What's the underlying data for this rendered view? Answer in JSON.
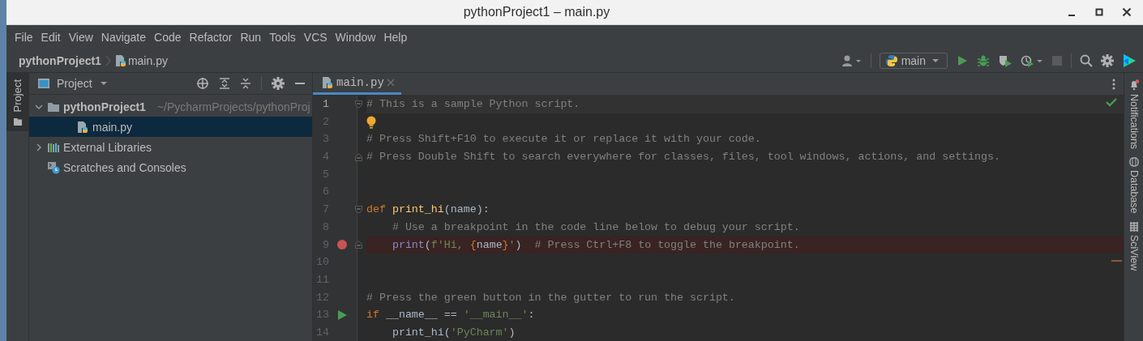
{
  "window": {
    "title": "pythonProject1 – main.py"
  },
  "menu": [
    "File",
    "Edit",
    "View",
    "Navigate",
    "Code",
    "Refactor",
    "Run",
    "Tools",
    "VCS",
    "Window",
    "Help"
  ],
  "breadcrumbs": [
    {
      "label": "pythonProject1",
      "kind": "project"
    },
    {
      "label": "main.py",
      "kind": "python-file"
    }
  ],
  "run_config": {
    "label": "main"
  },
  "left_strip": [
    {
      "label": "Project",
      "selected": true
    }
  ],
  "project_panel": {
    "title": "Project",
    "tree": [
      {
        "label": "pythonProject1",
        "path": "~/PycharmProjects/pythonProj",
        "kind": "folder",
        "expanded": true,
        "selected": false,
        "children": [
          {
            "label": "main.py",
            "kind": "python-file",
            "selected": true
          }
        ]
      },
      {
        "label": "External Libraries",
        "kind": "libraries",
        "expanded": false,
        "selected": false
      },
      {
        "label": "Scratches and Consoles",
        "kind": "scratches",
        "selected": false
      }
    ]
  },
  "editor": {
    "tabs": [
      {
        "label": "main.py",
        "selected": true
      }
    ],
    "lines": [
      {
        "number": "1",
        "current": true,
        "fold": {
          "kind": "start"
        },
        "tokens": [
          {
            "kind": "comment",
            "text": "# This is a sample Python script."
          }
        ]
      },
      {
        "number": "2",
        "current": false,
        "marker": {
          "kind": "bulb"
        }
      },
      {
        "number": "3",
        "current": false,
        "tokens": [
          {
            "kind": "comment",
            "text": "# Press Shift+F10 to execute it or replace it with your code."
          }
        ]
      },
      {
        "number": "4",
        "current": false,
        "fold": {
          "kind": "end"
        },
        "tokens": [
          {
            "kind": "comment",
            "text": "# Press Double Shift to search everywhere for classes, files, tool windows, actions, and settings."
          }
        ]
      },
      {
        "number": "5",
        "current": false
      },
      {
        "number": "6",
        "current": false
      },
      {
        "number": "7",
        "current": false,
        "fold": {
          "kind": "start"
        },
        "tokens": [
          {
            "kind": "keyword",
            "text": "def"
          },
          {
            "kind": "function",
            "text": " print_hi"
          },
          {
            "kind": "plain",
            "text": "(name):"
          }
        ]
      },
      {
        "number": "8",
        "current": false,
        "tokens": [
          {
            "kind": "comment",
            "text": "    # Use a breakpoint in the code line below to debug your script."
          }
        ]
      },
      {
        "number": "9",
        "current": false,
        "fold": {
          "kind": "end"
        },
        "marker": {
          "kind": "breakpoint"
        },
        "tokens": [
          {
            "kind": "builtin",
            "text": "    print"
          },
          {
            "kind": "plain",
            "text": "("
          },
          {
            "kind": "string",
            "text": "f'Hi, "
          },
          {
            "kind": "brace",
            "text": "{"
          },
          {
            "kind": "plain",
            "text": "name"
          },
          {
            "kind": "brace",
            "text": "}"
          },
          {
            "kind": "string",
            "text": "'"
          },
          {
            "kind": "plain",
            "text": ")"
          },
          {
            "kind": "comment",
            "text": "  # Press Ctrl+F8 to toggle the breakpoint."
          }
        ]
      },
      {
        "number": "10",
        "current": false
      },
      {
        "number": "11",
        "current": false
      },
      {
        "number": "12",
        "current": false,
        "tokens": [
          {
            "kind": "comment",
            "text": "# Press the green button in the gutter to run the script."
          }
        ]
      },
      {
        "number": "13",
        "current": false,
        "marker": {
          "kind": "run"
        },
        "tokens": [
          {
            "kind": "keyword",
            "text": "if"
          },
          {
            "kind": "plain",
            "text": " __name__ == "
          },
          {
            "kind": "string",
            "text": "'__main__'"
          },
          {
            "kind": "plain",
            "text": ":"
          }
        ]
      },
      {
        "number": "14",
        "current": false,
        "tokens": [
          {
            "kind": "plain",
            "text": "    print_hi("
          },
          {
            "kind": "string",
            "text": "'PyCharm'"
          },
          {
            "kind": "plain",
            "text": ")"
          }
        ]
      }
    ]
  },
  "right_strip": [
    {
      "label": "Notifications",
      "kind": "notifications"
    },
    {
      "label": "Database",
      "kind": "database"
    },
    {
      "label": "SciView",
      "kind": "sciview"
    }
  ]
}
